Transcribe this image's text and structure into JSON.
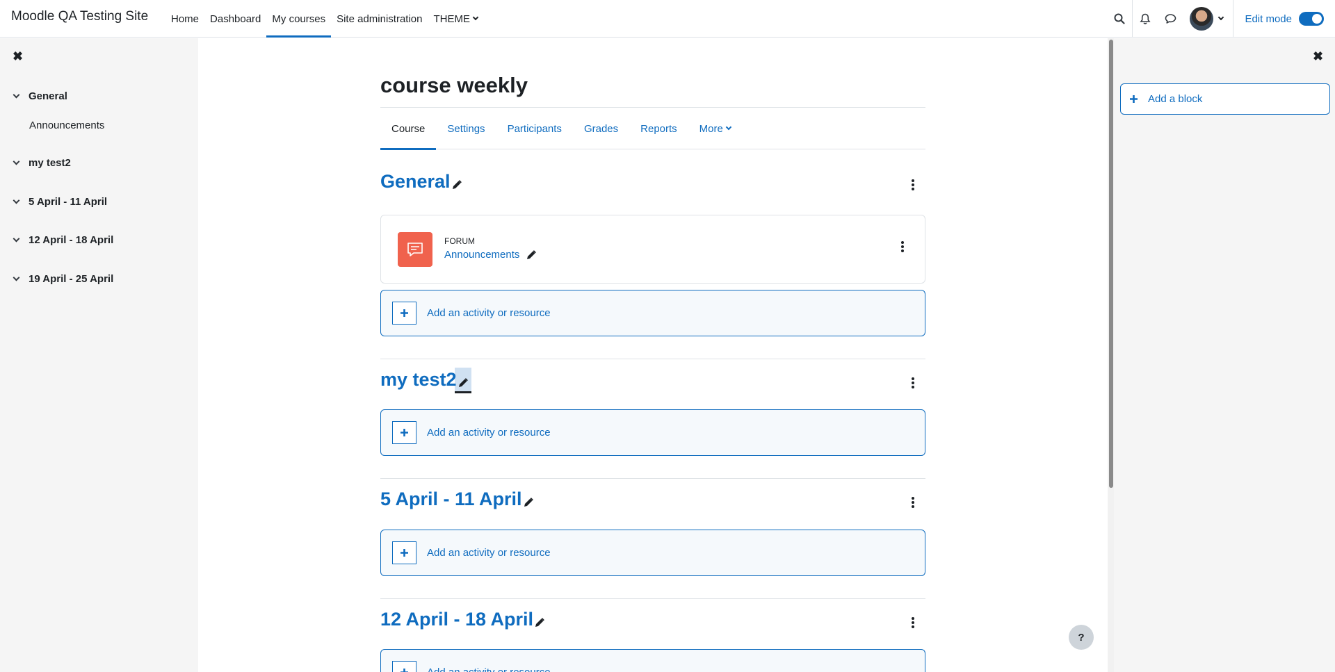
{
  "site": {
    "name": "Moodle QA Testing Site"
  },
  "primary_nav": [
    {
      "label": "Home"
    },
    {
      "label": "Dashboard"
    },
    {
      "label": "My courses",
      "active": true
    },
    {
      "label": "Site administration"
    },
    {
      "label": "THEME",
      "has_dropdown": true
    }
  ],
  "header_right": {
    "icons": [
      "search-icon",
      "bell-icon",
      "chat-icon"
    ],
    "edit_mode_label": "Edit mode",
    "edit_mode_on": true
  },
  "course_index": {
    "sections": [
      {
        "label": "General",
        "items": [
          "Announcements"
        ]
      },
      {
        "label": "my test2",
        "items": []
      },
      {
        "label": "5 April - 11 April",
        "items": []
      },
      {
        "label": "12 April - 18 April",
        "items": []
      },
      {
        "label": "19 April - 25 April",
        "items": []
      }
    ]
  },
  "page": {
    "title": "course weekly"
  },
  "secondary_nav": [
    {
      "label": "Course",
      "active": true
    },
    {
      "label": "Settings"
    },
    {
      "label": "Participants"
    },
    {
      "label": "Grades"
    },
    {
      "label": "Reports"
    },
    {
      "label": "More",
      "has_dropdown": true
    }
  ],
  "sections": [
    {
      "title": "General"
    },
    {
      "title": "my test2"
    },
    {
      "title": "5 April - 11 April"
    },
    {
      "title": "12 April - 18 April"
    }
  ],
  "activity": {
    "type": "FORUM",
    "name": "Announcements"
  },
  "add_activity_label": "Add an activity or resource",
  "blocks": {
    "add_block_label": "Add a block"
  },
  "help": {
    "label": "?"
  },
  "colors": {
    "accent": "#0f6cbf",
    "forum": "#f0624d",
    "drawer_bg": "#f5f5f5"
  }
}
